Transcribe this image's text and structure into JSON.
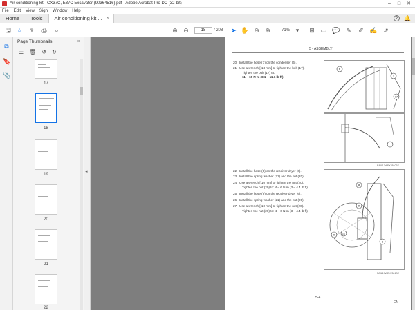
{
  "window": {
    "title": "Air conditioning kit - CX37C, E37C Excavator (90364516).pdf - Adobe Acrobat Pro DC (32-bit)",
    "controls": {
      "minimize": "–",
      "maximize": "□",
      "close": "✕"
    }
  },
  "menu": [
    "File",
    "Edit",
    "View",
    "Sign",
    "Window",
    "Help"
  ],
  "tabs": {
    "home": "Home",
    "tools": "Tools",
    "document": "Air conditioning kit ...",
    "close": "×"
  },
  "toolbar": {
    "page_current": "18",
    "page_total": "/ 208",
    "zoom": "71%"
  },
  "thumbnails": {
    "title": "Page Thumbnails",
    "close": "×",
    "pages": [
      "17",
      "18",
      "19",
      "20",
      "21",
      "22"
    ],
    "selected_page": "18"
  },
  "document": {
    "section_header": "5 - ASSEMBLY",
    "steps_top": [
      {
        "num": "20.",
        "text": "Install the hose (7) on the condenser (6)."
      },
      {
        "num": "21.",
        "text": "Use a wrench [ 13 mm] to tighten the bolt (17)."
      },
      {
        "num": "",
        "text": "Tighten the bolt (17) to:"
      },
      {
        "num": "",
        "text": "11 – 15 N·m (8.1 – 11.1 lb ft)"
      }
    ],
    "steps_bottom": [
      {
        "num": "22.",
        "text": "Install the hose (8) on the receiver-dryer (6)."
      },
      {
        "num": "23.",
        "text": "Install the spring washer (21) and the nut (20)."
      },
      {
        "num": "24.",
        "text": "Use a wrench [ 10 mm] to tighten the nut (20)."
      },
      {
        "num": "",
        "text": "Tighten the nut (20) to: 4 – 6 N·m (3 – 4.4 lb ft)"
      },
      {
        "num": "25.",
        "text": "Install the hose (9) on the receiver-dryer (6)."
      },
      {
        "num": "26.",
        "text": "Install the spring washer (21) and the nut (20)."
      },
      {
        "num": "27.",
        "text": "Use a wrench [ 10 mm] to tighten the nut (20)."
      },
      {
        "num": "",
        "text": "Tighten the nut (20) to: 4 – 6 N·m (3 – 4.4 lb ft)"
      }
    ],
    "figure1_caption": "RAIL17WEX2540BE",
    "figure2_caption": "RAIL17WEX2541BE",
    "callouts_fig1": [
      "6",
      "7",
      "17"
    ],
    "callouts_fig2": [
      "8",
      "9",
      "20",
      "21",
      "6"
    ],
    "page_number": "5-4",
    "language": "EN"
  }
}
